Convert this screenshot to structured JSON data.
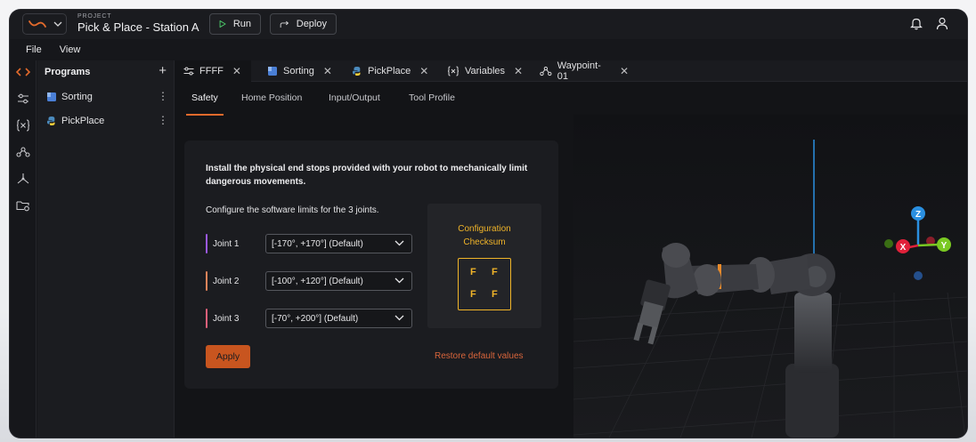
{
  "project": {
    "label": "PROJECT",
    "name": "Pick & Place - Station A"
  },
  "toolbar": {
    "run_label": "Run",
    "deploy_label": "Deploy"
  },
  "menu": {
    "file": "File",
    "view": "View"
  },
  "programs": {
    "header": "Programs",
    "items": [
      {
        "label": "Sorting"
      },
      {
        "label": "PickPlace"
      }
    ]
  },
  "tabs": [
    {
      "label": "FFFF",
      "icon": "sliders-icon"
    },
    {
      "label": "Sorting",
      "icon": "blocks-icon"
    },
    {
      "label": "PickPlace",
      "icon": "python-icon"
    },
    {
      "label": "Variables",
      "icon": "variables-icon"
    },
    {
      "label": "Waypoint-01",
      "icon": "waypoint-icon"
    }
  ],
  "subtabs": [
    "Safety",
    "Home Position",
    "Input/Output",
    "Tool Profile"
  ],
  "safety": {
    "info": "Install the physical end stops provided with your robot to mechanically limit dangerous movements.",
    "configure": "Configure the software limits for the 3 joints.",
    "joints": [
      {
        "label": "Joint 1",
        "value": "[-170°, +170°] (Default)",
        "color": "#9b59e6"
      },
      {
        "label": "Joint 2",
        "value": "[-100°, +120°] (Default)",
        "color": "#e8845a"
      },
      {
        "label": "Joint 3",
        "value": "[-70°, +200°] (Default)",
        "color": "#e0607a"
      }
    ],
    "checksum": {
      "title_line1": "Configuration",
      "title_line2": "Checksum",
      "cells": [
        "F",
        "F",
        "F",
        "F"
      ]
    },
    "apply_label": "Apply",
    "restore_label": "Restore default values"
  },
  "gizmo": {
    "z": "Z",
    "x": "X",
    "y": "Y"
  },
  "colors": {
    "accent": "#e26a2c",
    "checksum": "#f0b429",
    "axis_x": "#e0213a",
    "axis_y": "#7ac922",
    "axis_z": "#2a8fe0"
  }
}
